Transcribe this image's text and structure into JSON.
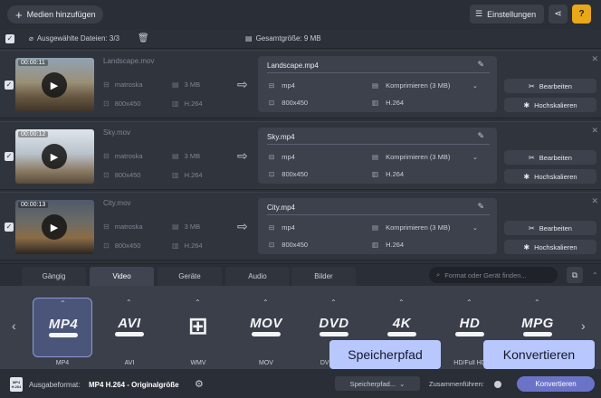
{
  "toolbar": {
    "add_media_label": "Medien hinzufügen",
    "settings_label": "Einstellungen",
    "help_label": "?"
  },
  "info": {
    "selected_files": "Ausgewählte Dateien: 3/3",
    "total_size": "Gesamtgröße: 9 MB"
  },
  "files": [
    {
      "duration": "00:00:11",
      "source_name": "Landscape.mov",
      "source_container": "matroska",
      "source_size": "3 MB",
      "source_resolution": "800x450",
      "source_codec": "H.264",
      "output_name": "Landscape.mp4",
      "output_format": "mp4",
      "output_quality": "Komprimieren (3 MB)",
      "output_resolution": "800x450",
      "output_codec": "H.264",
      "edit_label": "Bearbeiten",
      "upscale_label": "Hochskalieren"
    },
    {
      "duration": "00:00:12",
      "source_name": "Sky.mov",
      "source_container": "matroska",
      "source_size": "3 MB",
      "source_resolution": "800x450",
      "source_codec": "H.264",
      "output_name": "Sky.mp4",
      "output_format": "mp4",
      "output_quality": "Komprimieren (3 MB)",
      "output_resolution": "800x450",
      "output_codec": "H.264",
      "edit_label": "Bearbeiten",
      "upscale_label": "Hochskalieren"
    },
    {
      "duration": "00:00:13",
      "source_name": "City.mov",
      "source_container": "matroska",
      "source_size": "3 MB",
      "source_resolution": "800x450",
      "source_codec": "H.264",
      "output_name": "City.mp4",
      "output_format": "mp4",
      "output_quality": "Komprimieren (3 MB)",
      "output_resolution": "800x450",
      "output_codec": "H.264",
      "edit_label": "Bearbeiten",
      "upscale_label": "Hochskalieren"
    }
  ],
  "tabs": [
    {
      "label": "Gängig"
    },
    {
      "label": "Video",
      "active": true
    },
    {
      "label": "Geräte"
    },
    {
      "label": "Audio"
    },
    {
      "label": "Bilder"
    }
  ],
  "search": {
    "placeholder": "Format oder Gerät finden..."
  },
  "formats": [
    {
      "logo": "MP4",
      "label": "MP4",
      "selected": true
    },
    {
      "logo": "AVI",
      "label": "AVI"
    },
    {
      "logo": "⊞",
      "label": "WMV"
    },
    {
      "logo": "MOV",
      "label": "MOV"
    },
    {
      "logo": "DVD",
      "label": "DVD-kom"
    },
    {
      "logo": "4K",
      "label": ""
    },
    {
      "logo": "HD",
      "label": "HD/Full HD"
    },
    {
      "logo": "MPG",
      "label": ""
    }
  ],
  "bottom": {
    "output_format_label": "Ausgabeformat:",
    "output_format_value": "MP4 H.264 - Originalgröße",
    "save_path_label": "Speicherpfad...",
    "merge_label": "Zusammenführen:",
    "convert_label": "Konvertieren"
  },
  "tooltips": {
    "save_path": "Speicherpfad",
    "convert": "Konvertieren"
  },
  "colors": {
    "accent": "#6b73c9",
    "help": "#e8a817",
    "tooltip": "#b8c8ff"
  }
}
